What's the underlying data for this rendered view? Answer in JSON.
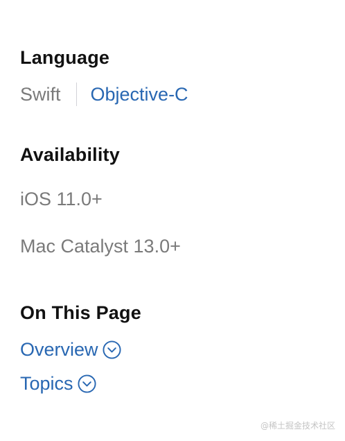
{
  "language": {
    "heading": "Language",
    "current": "Swift",
    "alternate": "Objective-C"
  },
  "availability": {
    "heading": "Availability",
    "platforms": [
      "iOS 11.0+",
      "Mac Catalyst 13.0+"
    ]
  },
  "on_this_page": {
    "heading": "On This Page",
    "links": [
      {
        "label": "Overview",
        "icon": "chevron-down-circle-icon"
      },
      {
        "label": "Topics",
        "icon": "chevron-down-circle-icon"
      }
    ]
  },
  "watermark": "@稀土掘金技术社区",
  "colors": {
    "link": "#2867b2",
    "muted": "#7a7a7a",
    "heading": "#111111",
    "divider": "#d2d2d7"
  }
}
